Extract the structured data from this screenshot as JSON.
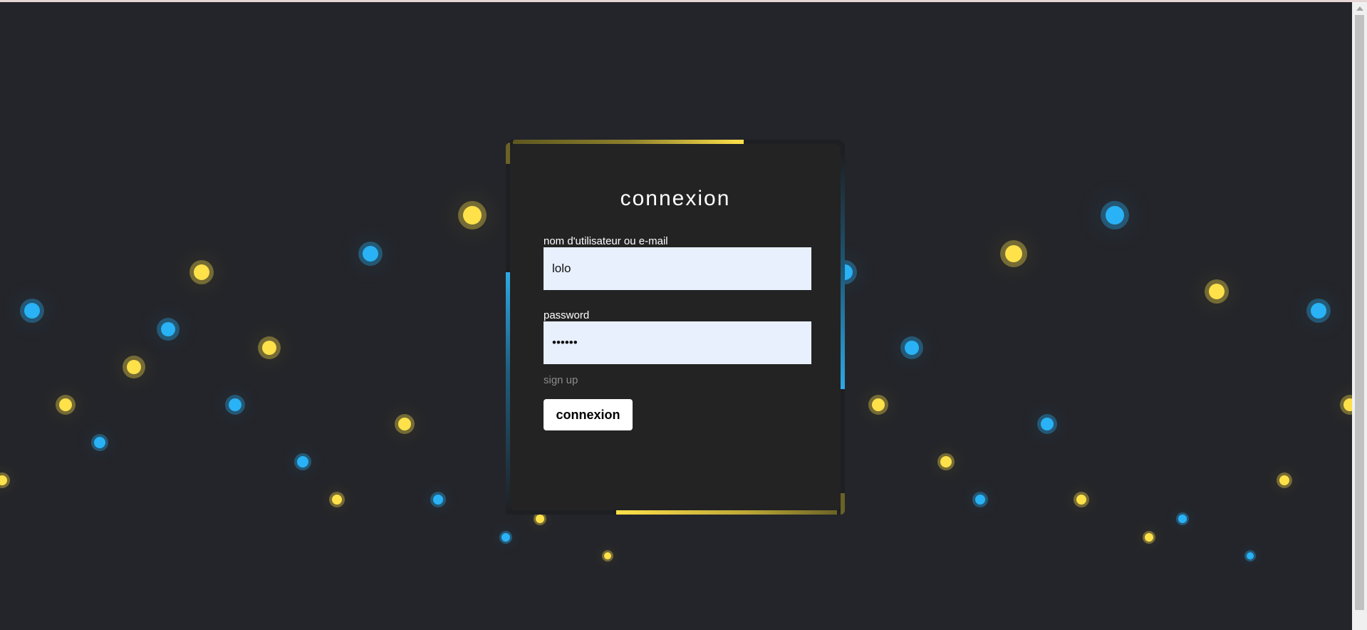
{
  "login": {
    "title": "connexion",
    "username_label": "nom d'utilisateur ou e-mail",
    "username_value": "lolo",
    "password_label": "password",
    "password_value": "••••••",
    "signup_link": "sign up",
    "submit_label": "connexion"
  },
  "colors": {
    "background": "#24252a",
    "card": "#232323",
    "accent_yellow": "#ffe14a",
    "accent_blue": "#29b2f6"
  }
}
